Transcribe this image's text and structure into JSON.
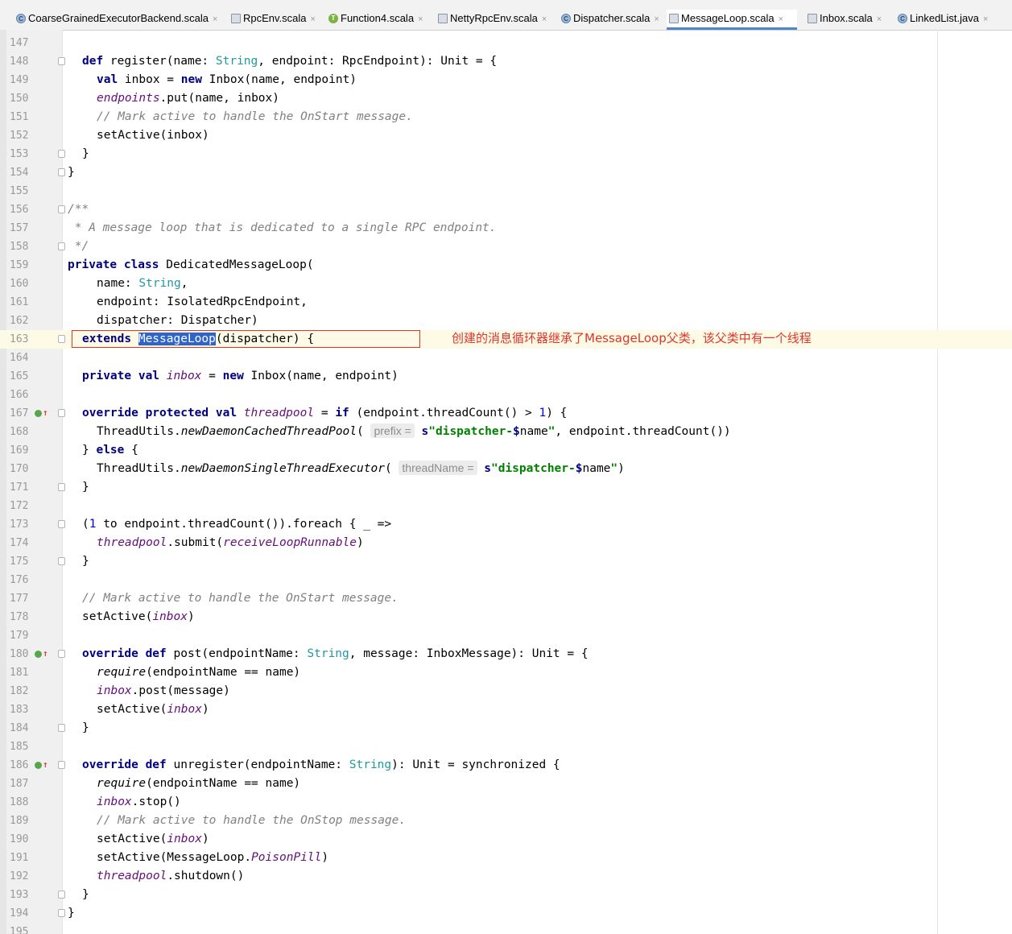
{
  "tabs": [
    {
      "label": "CoarseGrainedExecutorBackend.scala",
      "icon": "scala-class-icon",
      "active": false
    },
    {
      "label": "RpcEnv.scala",
      "icon": "scala-file-icon",
      "active": false
    },
    {
      "label": "Function4.scala",
      "icon": "scala-trait-icon",
      "active": false
    },
    {
      "label": "NettyRpcEnv.scala",
      "icon": "scala-file-icon",
      "active": false
    },
    {
      "label": "Dispatcher.scala",
      "icon": "scala-class-icon",
      "active": false
    },
    {
      "label": "MessageLoop.scala",
      "icon": "scala-file-icon",
      "active": true
    },
    {
      "label": "Inbox.scala",
      "icon": "scala-file-icon",
      "active": false
    },
    {
      "label": "LinkedList.java",
      "icon": "java-class-icon",
      "active": false
    }
  ],
  "close_glyph": "×",
  "line_numbers": [
    "147",
    "148",
    "149",
    "150",
    "151",
    "152",
    "153",
    "154",
    "155",
    "156",
    "157",
    "158",
    "159",
    "160",
    "161",
    "162",
    "163",
    "164",
    "165",
    "166",
    "167",
    "168",
    "169",
    "170",
    "171",
    "172",
    "173",
    "174",
    "175",
    "176",
    "177",
    "178",
    "179",
    "180",
    "181",
    "182",
    "183",
    "184",
    "185",
    "186",
    "187",
    "188",
    "189",
    "190",
    "191",
    "192",
    "193",
    "194",
    "195"
  ],
  "code": {
    "l148": {
      "a": "def",
      "b": " register(name: ",
      "c": "String",
      "d": ", endpoint: RpcEndpoint): Unit = {"
    },
    "l149": {
      "a": "val",
      "b": " inbox = ",
      "c": "new",
      "d": " Inbox(name, endpoint)"
    },
    "l150": {
      "a": "endpoints",
      "b": ".put(name, inbox)"
    },
    "l151": "// Mark active to handle the OnStart message.",
    "l152": "setActive(inbox)",
    "l153": "}",
    "l154": "}",
    "l156": "/**",
    "l157": " * A message loop that is dedicated to a single RPC endpoint.",
    "l158": " */",
    "l159": {
      "a": "private class",
      "b": " DedicatedMessageLoop("
    },
    "l160": {
      "a": "name: ",
      "b": "String",
      "c": ","
    },
    "l161": "endpoint: IsolatedRpcEndpoint,",
    "l162": "dispatcher: Dispatcher)",
    "l163": {
      "a": "extends",
      "b": " ",
      "c": "MessageLoop",
      "d": "(dispatcher) {"
    },
    "l165": {
      "a": "private val",
      "b": " ",
      "c": "inbox",
      "d": " = ",
      "e": "new",
      "f": " Inbox(name, endpoint)"
    },
    "l167": {
      "a": "override protected val",
      "b": " ",
      "c": "threadpool",
      "d": " = ",
      "e": "if",
      "f": " (endpoint.threadCount() > ",
      "g": "1",
      "h": ") {"
    },
    "l168": {
      "a": "ThreadUtils.",
      "b": "newDaemonCachedThreadPool",
      "c": "( ",
      "d": "prefix =",
      "e": " s",
      "f": "\"dispatcher-",
      "g": "$",
      "h": "name",
      "i": "\"",
      "j": ", endpoint.threadCount())"
    },
    "l169": {
      "a": "} ",
      "b": "else",
      "c": " {"
    },
    "l170": {
      "a": "ThreadUtils.",
      "b": "newDaemonSingleThreadExecutor",
      "c": "( ",
      "d": "threadName =",
      "e": " s",
      "f": "\"dispatcher-",
      "g": "$",
      "h": "name",
      "i": "\"",
      "j": ")"
    },
    "l171": "}",
    "l173": {
      "a": "(",
      "b": "1",
      "c": " to endpoint.threadCount()).foreach { _ =>"
    },
    "l174": {
      "a": "threadpool",
      "b": ".submit(",
      "c": "receiveLoopRunnable",
      "d": ")"
    },
    "l175": "}",
    "l177": "// Mark active to handle the OnStart message.",
    "l178": {
      "a": "setActive(",
      "b": "inbox",
      "c": ")"
    },
    "l180": {
      "a": "override def",
      "b": " post(endpointName: ",
      "c": "String",
      "d": ", message: InboxMessage): Unit = {"
    },
    "l181": {
      "a": "require",
      "b": "(endpointName == name)"
    },
    "l182": {
      "a": "inbox",
      "b": ".post(message)"
    },
    "l183": {
      "a": "setActive(",
      "b": "inbox",
      "c": ")"
    },
    "l184": "}",
    "l186": {
      "a": "override def",
      "b": " unregister(endpointName: ",
      "c": "String",
      "d": "): Unit = synchronized {"
    },
    "l187": {
      "a": "require",
      "b": "(endpointName == name)"
    },
    "l188": {
      "a": "inbox",
      "b": ".stop()"
    },
    "l189": "// Mark active to handle the OnStop message.",
    "l190": {
      "a": "setActive(",
      "b": "inbox",
      "c": ")"
    },
    "l191": {
      "a": "setActive(MessageLoop.",
      "b": "PoisonPill",
      "c": ")"
    },
    "l192": {
      "a": "threadpool",
      "b": ".shutdown()"
    },
    "l193": "}",
    "l194": "}"
  },
  "annotation": "创建的消息循环器继承了MessageLoop父类，该父类中有一个线程",
  "colors": {
    "keyword": "#000080",
    "string": "#008000",
    "comment": "#808080",
    "type": "#20999d",
    "field": "#660e7a",
    "number": "#0000ff",
    "selection": "#2f65ca",
    "annotation": "#e0342e",
    "current_line": "#fdfbe6"
  }
}
